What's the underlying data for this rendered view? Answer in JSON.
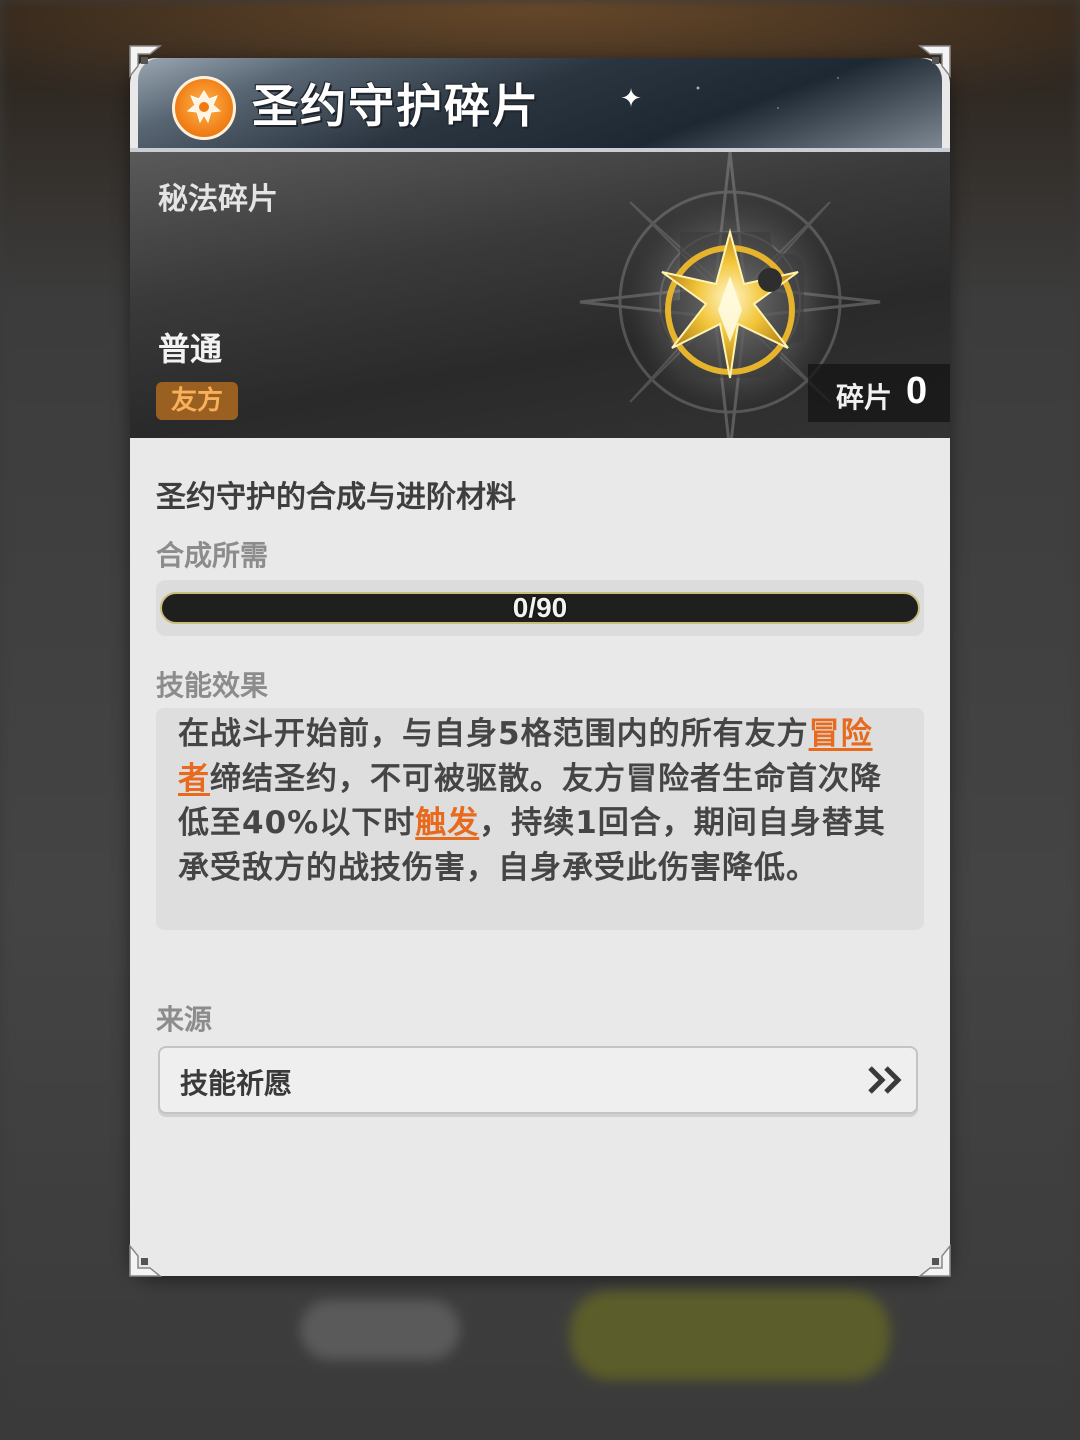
{
  "item": {
    "title": "圣约守护碎片",
    "category": "秘法碎片",
    "rarity": "普通",
    "faction_badge": "友方",
    "fragment_count_label": "碎片",
    "fragment_count": "0",
    "emblem_icon": "orange-rarity-emblem-icon",
    "art_icon": "golden-puzzle-fragment-icon"
  },
  "details": {
    "description": "圣约守护的合成与进阶材料",
    "craft_label": "合成所需",
    "progress": {
      "text": "0/90",
      "current": 0,
      "total": 90
    },
    "skill_label": "技能效果",
    "skill_text": {
      "part1": "在战斗开始前，与自身5格范围内的所有友方",
      "kw1": "冒险者",
      "part2": "缔结圣约，不可被驱散。友方冒险者生命首次降低至40%以下时",
      "kw2": "触发",
      "part3": "，持续1回合，期间自身替其承受敌方的战技伤害，自身承受此伤害降低。"
    },
    "source_label": "来源",
    "source_item": "技能祈愿"
  },
  "colors": {
    "keyword": "#e86a1e",
    "badge_bg": "#9a6022",
    "badge_text": "#f9b05a",
    "emblem": "#f07a12",
    "progress_fill": "#e1c45a"
  }
}
